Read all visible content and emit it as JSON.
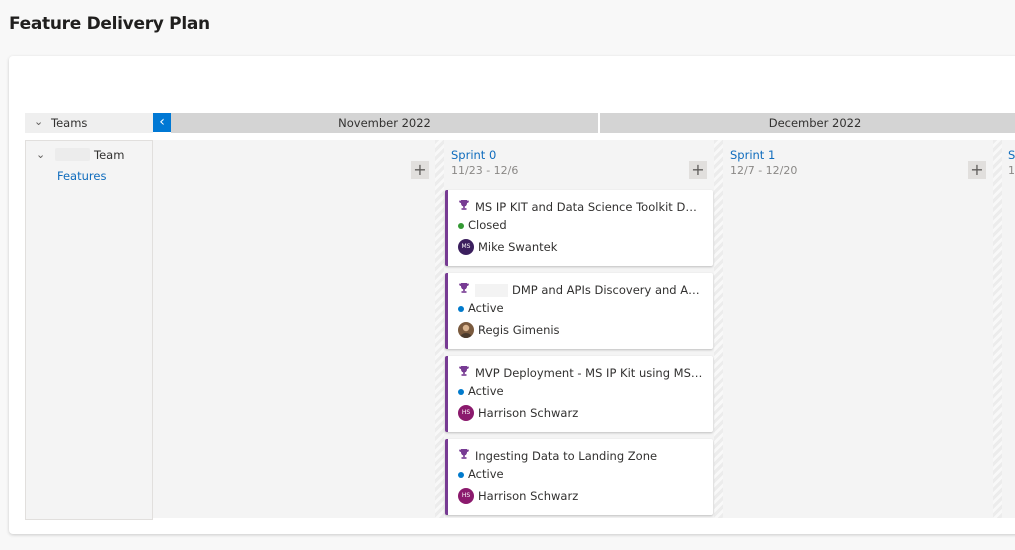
{
  "page": {
    "title": "Feature Delivery Plan"
  },
  "timeline": {
    "teams_header": "Teams",
    "prev_icon": "chevron-left-icon",
    "months": [
      "November 2022",
      "December 2022"
    ]
  },
  "team": {
    "name": "Team",
    "backlog_link": "Features"
  },
  "sprints": [
    {
      "name": "Sprint 0",
      "dates": "11/23 - 12/6"
    },
    {
      "name": "Sprint 1",
      "dates": "12/7 - 12/20"
    },
    {
      "name": "S",
      "dates": "1"
    }
  ],
  "add_label": "+",
  "cards": [
    {
      "title": "MS IP KIT and Data Science Toolkit Demos",
      "state": "Closed",
      "state_color": "#339933",
      "assignee": "Mike Swantek",
      "avatar_initials": "MS",
      "avatar_color": "#3b1f5e"
    },
    {
      "title": "DMP and APIs Discovery and Assessment",
      "state": "Active",
      "state_color": "#007acc",
      "assignee": "Regis Gimenis",
      "avatar_initials": "",
      "avatar_color": "#7a5a3e"
    },
    {
      "title": "MVP Deployment - MS IP Kit using MS NATIVE Services",
      "state": "Active",
      "state_color": "#007acc",
      "assignee": "Harrison Schwarz",
      "avatar_initials": "HS",
      "avatar_color": "#8b1a6d"
    },
    {
      "title": "Ingesting Data to Landing Zone",
      "state": "Active",
      "state_color": "#007acc",
      "assignee": "Harrison Schwarz",
      "avatar_initials": "HS",
      "avatar_color": "#8b1a6d"
    }
  ],
  "colors": {
    "accent": "#0078d4",
    "feature": "#773b93"
  }
}
